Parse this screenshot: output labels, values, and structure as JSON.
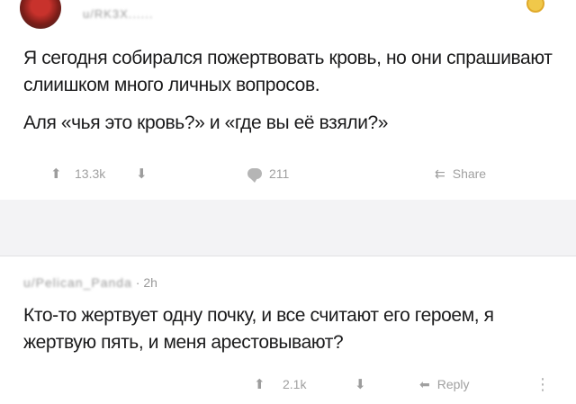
{
  "post": {
    "username": "u/RK3X......",
    "text_line1": "Я сегодня собирался пожертвовать кровь, но они спрашивают слиишком много личных вопросов.",
    "text_line2": "Аля «чья это кровь?» и «где вы её взяли?»",
    "votes": "13.3k",
    "comments": "211",
    "share_label": "Share"
  },
  "comment": {
    "username": "u/Pelican_Panda",
    "separator": "·",
    "age": "2h",
    "text": "Кто-то жертвует одну почку, и все считают его героем, я жертвую пять, и меня арестовывают?",
    "votes": "2.1k",
    "reply_label": "Reply"
  },
  "icons": {
    "upvote": "⬆",
    "downvote": "⬇",
    "share": "⇇",
    "reply": "⬅",
    "more": "⋮"
  }
}
